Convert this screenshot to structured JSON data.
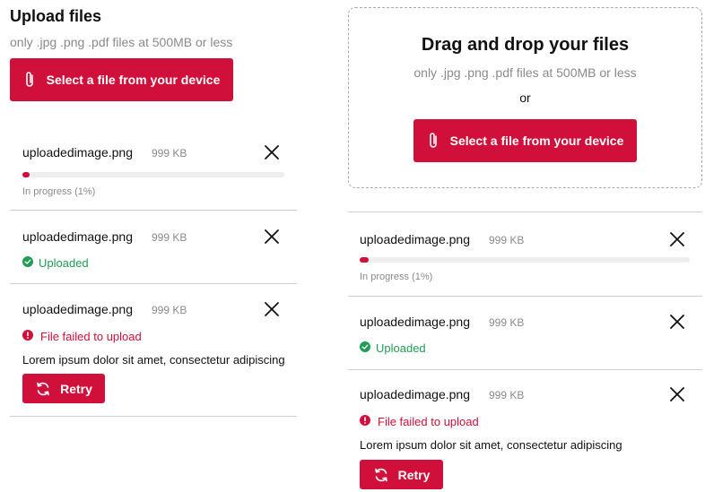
{
  "left": {
    "title": "Upload files",
    "subtitle": "only .jpg .png .pdf files at 500MB or less",
    "select_button": "Select a file from your device"
  },
  "dropzone": {
    "title": "Drag and drop your files",
    "subtitle": "only .jpg .png .pdf files at 500MB or less",
    "or": "or",
    "select_button": "Select a file from your device"
  },
  "files": [
    {
      "name": "uploadedimage.png",
      "size": "999 KB",
      "status": "in-progress",
      "progress": 0.01,
      "status_text": "In progress (1%)"
    },
    {
      "name": "uploadedimage.png",
      "size": "999 KB",
      "status": "uploaded",
      "status_text": "Uploaded"
    },
    {
      "name": "uploadedimage.png",
      "size": "999 KB",
      "status": "failed",
      "status_text": "File failed to upload",
      "error_detail": "Lorem ipsum dolor sit amet, consectetur adipiscing",
      "retry_label": "Retry"
    }
  ],
  "colors": {
    "accent": "#d0103a",
    "success": "#1f9d55",
    "muted": "#8a8a8a"
  },
  "icons": {
    "attach": "paperclip-icon",
    "close": "close-icon",
    "success": "check-circle-icon",
    "error": "alert-circle-icon",
    "retry": "refresh-icon"
  }
}
